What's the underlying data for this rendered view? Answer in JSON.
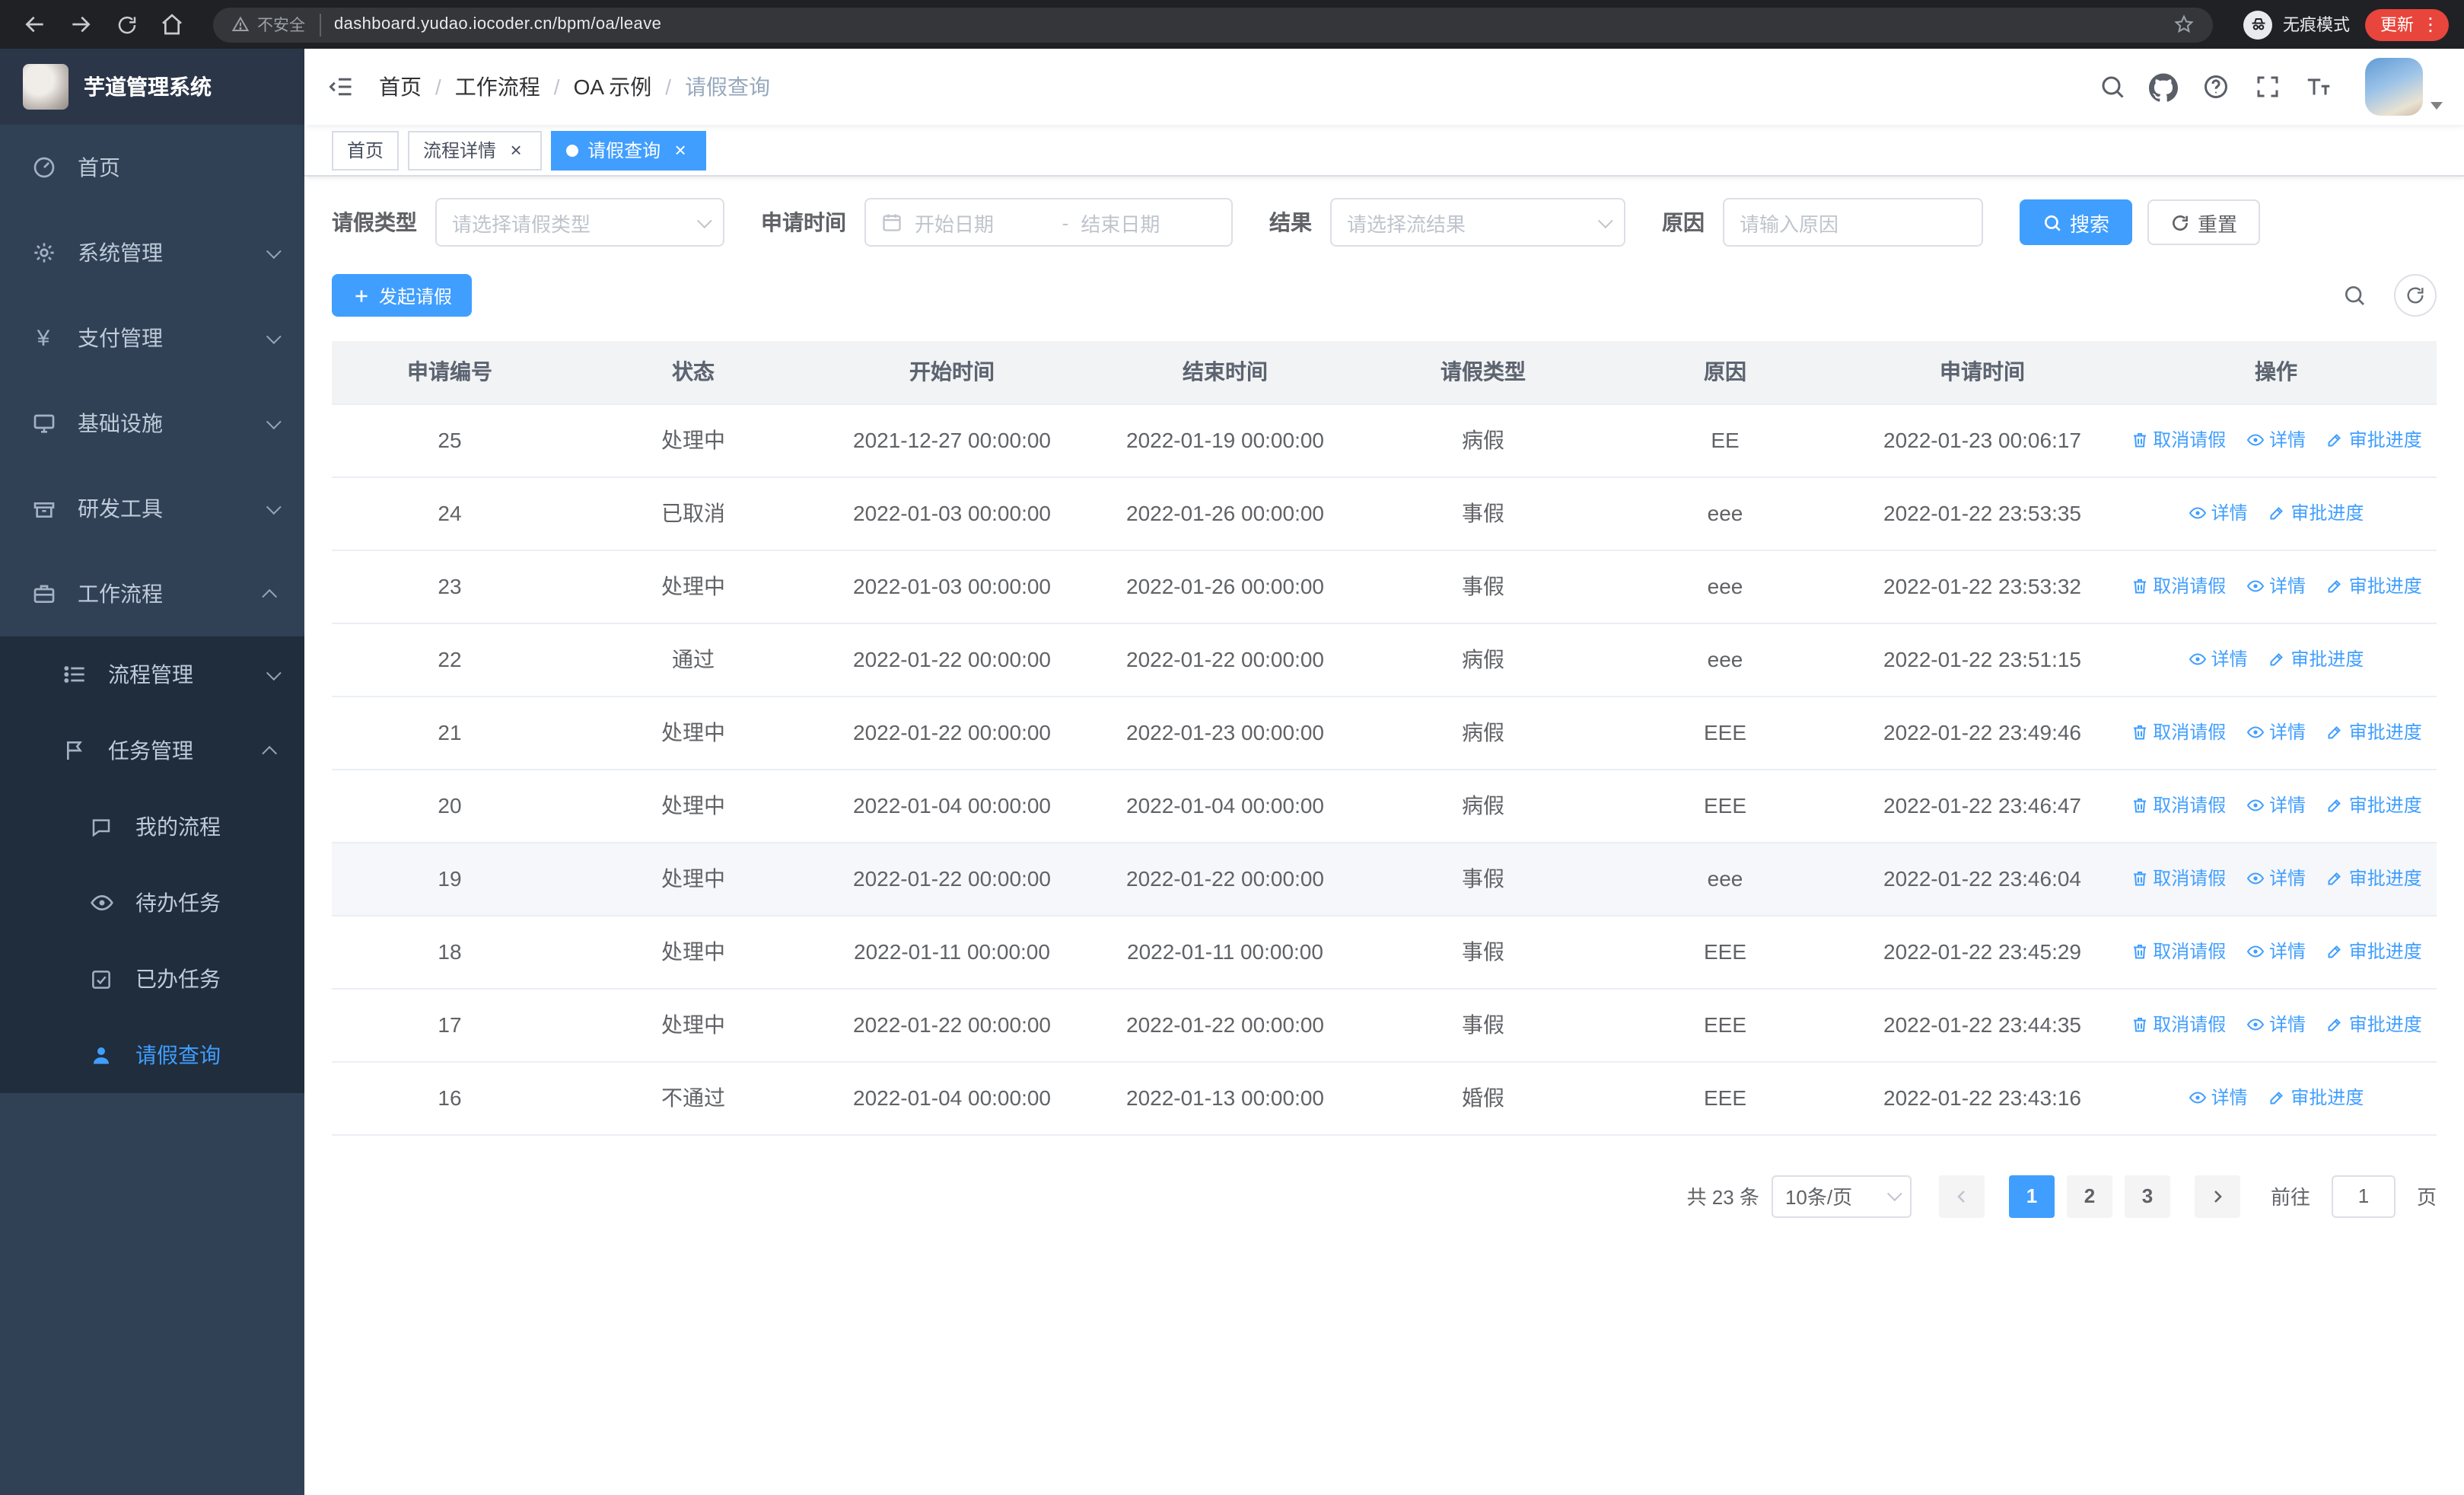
{
  "browser": {
    "security_label": "不安全",
    "url": "dashboard.yudao.iocoder.cn/bpm/oa/leave",
    "incognito_label": "无痕模式",
    "update_label": "更新"
  },
  "icons": {
    "close": "×",
    "more": "⋮",
    "yen": "¥"
  },
  "sidebar": {
    "logo_title": "芋道管理系统",
    "items": [
      {
        "label": "首页"
      },
      {
        "label": "系统管理"
      },
      {
        "label": "支付管理"
      },
      {
        "label": "基础设施"
      },
      {
        "label": "研发工具"
      },
      {
        "label": "工作流程"
      }
    ],
    "submenu": [
      {
        "label": "流程管理"
      },
      {
        "label": "任务管理"
      }
    ],
    "task_children": [
      {
        "label": "我的流程"
      },
      {
        "label": "待办任务"
      },
      {
        "label": "已办任务"
      },
      {
        "label": "请假查询"
      }
    ]
  },
  "header": {
    "breadcrumb": [
      "首页",
      "工作流程",
      "OA 示例",
      "请假查询"
    ]
  },
  "tabs": [
    {
      "label": "首页"
    },
    {
      "label": "流程详情"
    },
    {
      "label": "请假查询"
    }
  ],
  "filters": {
    "leave_type_label": "请假类型",
    "leave_type_placeholder": "请选择请假类型",
    "apply_time_label": "申请时间",
    "start_date_placeholder": "开始日期",
    "range_separator": "-",
    "end_date_placeholder": "结束日期",
    "result_label": "结果",
    "result_placeholder": "请选择流结果",
    "reason_label": "原因",
    "reason_placeholder": "请输入原因",
    "search_label": "搜索",
    "reset_label": "重置"
  },
  "toolbar": {
    "create_label": "发起请假"
  },
  "table": {
    "columns": [
      "申请编号",
      "状态",
      "开始时间",
      "结束时间",
      "请假类型",
      "原因",
      "申请时间",
      "操作"
    ],
    "action_labels": {
      "cancel": "取消请假",
      "detail": "详情",
      "progress": "审批进度"
    },
    "rows": [
      {
        "id": "25",
        "status": "处理中",
        "start": "2021-12-27 00:00:00",
        "end": "2022-01-19 00:00:00",
        "type": "病假",
        "reason": "EE",
        "applied": "2022-01-23 00:06:17",
        "actions": [
          "cancel",
          "detail",
          "progress"
        ]
      },
      {
        "id": "24",
        "status": "已取消",
        "start": "2022-01-03 00:00:00",
        "end": "2022-01-26 00:00:00",
        "type": "事假",
        "reason": "eee",
        "applied": "2022-01-22 23:53:35",
        "actions": [
          "detail",
          "progress"
        ]
      },
      {
        "id": "23",
        "status": "处理中",
        "start": "2022-01-03 00:00:00",
        "end": "2022-01-26 00:00:00",
        "type": "事假",
        "reason": "eee",
        "applied": "2022-01-22 23:53:32",
        "actions": [
          "cancel",
          "detail",
          "progress"
        ]
      },
      {
        "id": "22",
        "status": "通过",
        "start": "2022-01-22 00:00:00",
        "end": "2022-01-22 00:00:00",
        "type": "病假",
        "reason": "eee",
        "applied": "2022-01-22 23:51:15",
        "actions": [
          "detail",
          "progress"
        ]
      },
      {
        "id": "21",
        "status": "处理中",
        "start": "2022-01-22 00:00:00",
        "end": "2022-01-23 00:00:00",
        "type": "病假",
        "reason": "EEE",
        "applied": "2022-01-22 23:49:46",
        "actions": [
          "cancel",
          "detail",
          "progress"
        ]
      },
      {
        "id": "20",
        "status": "处理中",
        "start": "2022-01-04 00:00:00",
        "end": "2022-01-04 00:00:00",
        "type": "病假",
        "reason": "EEE",
        "applied": "2022-01-22 23:46:47",
        "actions": [
          "cancel",
          "detail",
          "progress"
        ]
      },
      {
        "id": "19",
        "status": "处理中",
        "start": "2022-01-22 00:00:00",
        "end": "2022-01-22 00:00:00",
        "type": "事假",
        "reason": "eee",
        "applied": "2022-01-22 23:46:04",
        "actions": [
          "cancel",
          "detail",
          "progress"
        ],
        "hover": true
      },
      {
        "id": "18",
        "status": "处理中",
        "start": "2022-01-11 00:00:00",
        "end": "2022-01-11 00:00:00",
        "type": "事假",
        "reason": "EEE",
        "applied": "2022-01-22 23:45:29",
        "actions": [
          "cancel",
          "detail",
          "progress"
        ]
      },
      {
        "id": "17",
        "status": "处理中",
        "start": "2022-01-22 00:00:00",
        "end": "2022-01-22 00:00:00",
        "type": "事假",
        "reason": "EEE",
        "applied": "2022-01-22 23:44:35",
        "actions": [
          "cancel",
          "detail",
          "progress"
        ]
      },
      {
        "id": "16",
        "status": "不通过",
        "start": "2022-01-04 00:00:00",
        "end": "2022-01-13 00:00:00",
        "type": "婚假",
        "reason": "EEE",
        "applied": "2022-01-22 23:43:16",
        "actions": [
          "detail",
          "progress"
        ]
      }
    ]
  },
  "pagination": {
    "total_label": "共 23 条",
    "page_size_label": "10条/页",
    "pages": [
      "1",
      "2",
      "3"
    ],
    "active_page": "1",
    "goto_label": "前往",
    "goto_value": "1",
    "goto_suffix": "页"
  },
  "colors": {
    "accent": "#409eff",
    "sidebar_bg": "#304156",
    "submenu_bg": "#1f2d3d",
    "browser_bar_bg": "#202124",
    "update_pill_bg": "#e8453c",
    "table_header_bg": "#f2f3f5"
  }
}
